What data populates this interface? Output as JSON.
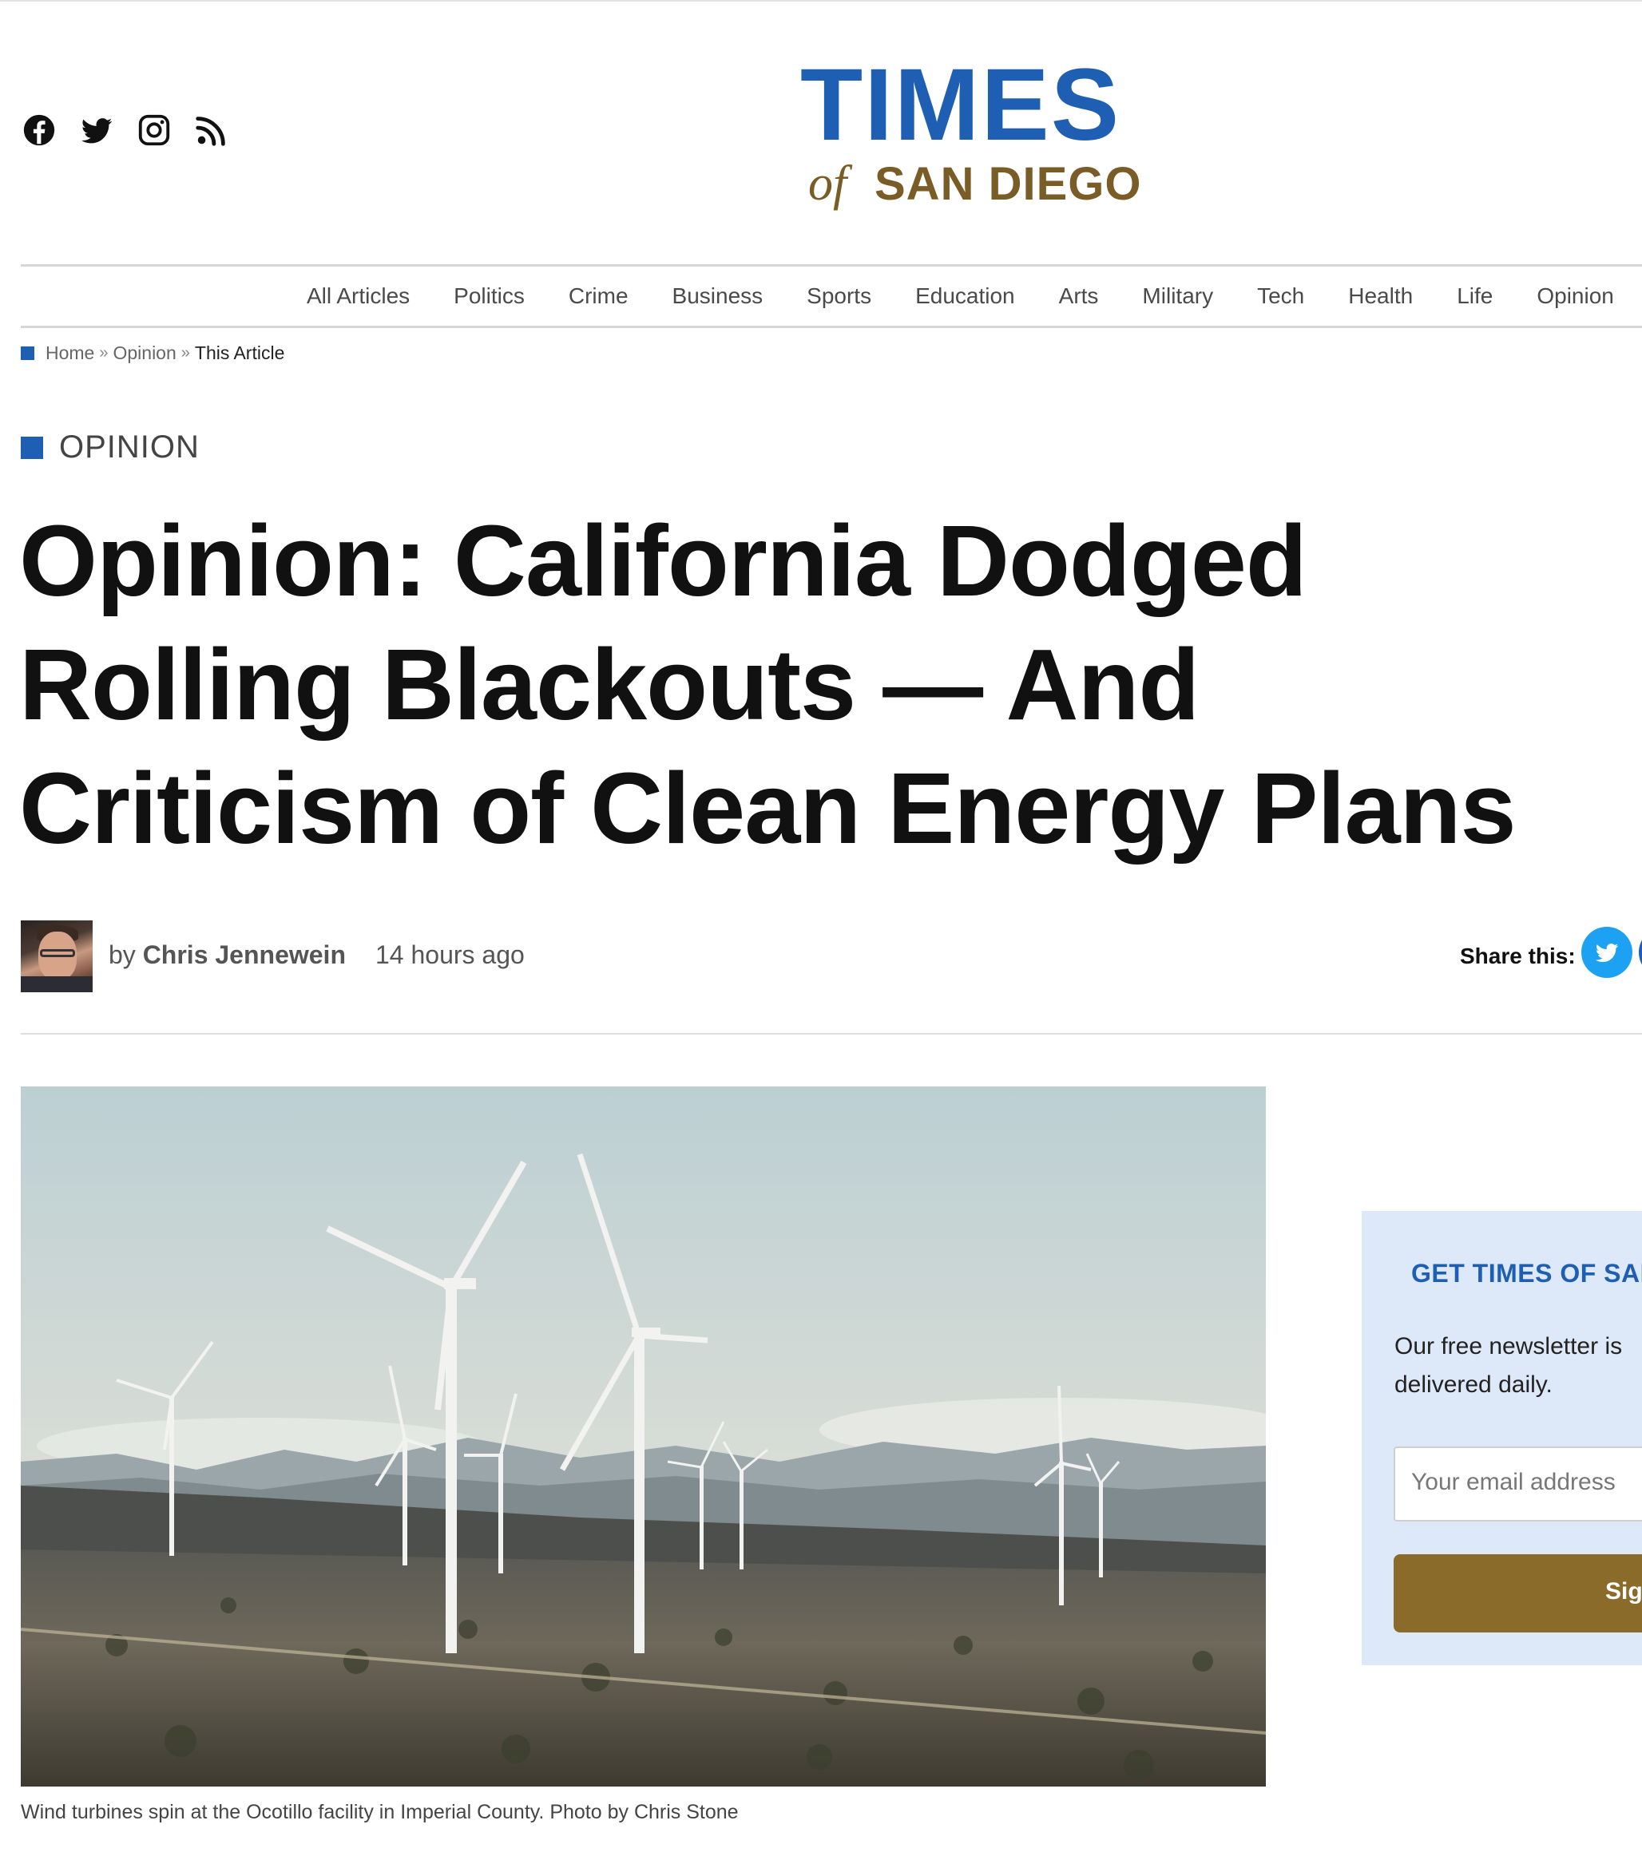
{
  "logo": {
    "line1": "TIMES",
    "line2_of": "of",
    "line2_rest": "SAN DIEGO",
    "color_blue": "#1f5fb3",
    "color_gold": "#7a5c26"
  },
  "social_icons": [
    "facebook-icon",
    "twitter-icon",
    "instagram-icon",
    "rss-icon"
  ],
  "nav": {
    "items": [
      "All Articles",
      "Politics",
      "Crime",
      "Business",
      "Sports",
      "Education",
      "Arts",
      "Military",
      "Tech",
      "Health",
      "Life",
      "Opinion"
    ]
  },
  "breadcrumb": {
    "home": "Home",
    "sep": "»",
    "section": "Opinion",
    "current": "This Article"
  },
  "article": {
    "category": "OPINION",
    "headline": "Opinion: California Dodged Rolling Blackouts — And Criticism of Clean Energy Plans",
    "by": "by",
    "author": "Chris Jennewein",
    "time": "14 hours ago",
    "share_label": "Share this:",
    "caption": "Wind turbines spin at the Ocotillo facility in Imperial County. Photo by Chris Stone"
  },
  "newsletter": {
    "title": "GET TIMES OF SAN DIEGO",
    "description": "Our free newsletter is delivered daily.",
    "email_placeholder": "Your email address",
    "button": "Sign Up"
  },
  "colors": {
    "accent_blue": "#1f5fb3",
    "button_gold": "#8b6b2a",
    "newsletter_bg": "#dde9f8",
    "twitter_blue": "#1da1f2"
  }
}
